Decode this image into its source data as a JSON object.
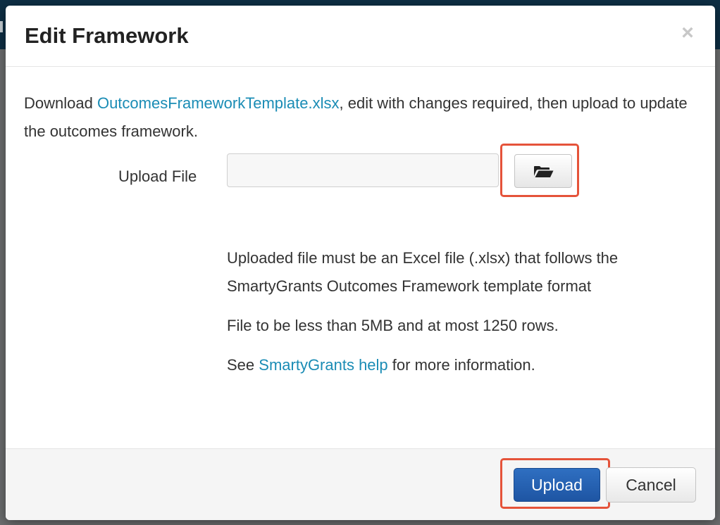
{
  "modal": {
    "title": "Edit Framework",
    "close_glyph": "×",
    "close_icon": "close-icon"
  },
  "body": {
    "intro_prefix": "Download ",
    "template_link": "OutcomesFrameworkTemplate.xlsx",
    "intro_suffix": ", edit with changes required, then upload to update the outcomes framework.",
    "upload_label": "Upload File",
    "file_input_value": "",
    "browse_icon": "folder-open-icon",
    "help_line_1": "Uploaded file must be an Excel file (.xlsx) that follows the SmartyGrants Outcomes Framework template format",
    "help_line_2": "File to be less than 5MB and at most 1250 rows.",
    "help_line_3_prefix": "See ",
    "help_link": "SmartyGrants help",
    "help_line_3_suffix": " for more information."
  },
  "footer": {
    "upload_label": "Upload",
    "cancel_label": "Cancel"
  },
  "colors": {
    "link": "#1a8cb5",
    "primary_button": "#1e55a3",
    "highlight": "#e5533a",
    "topbar": "#0e2f45"
  }
}
